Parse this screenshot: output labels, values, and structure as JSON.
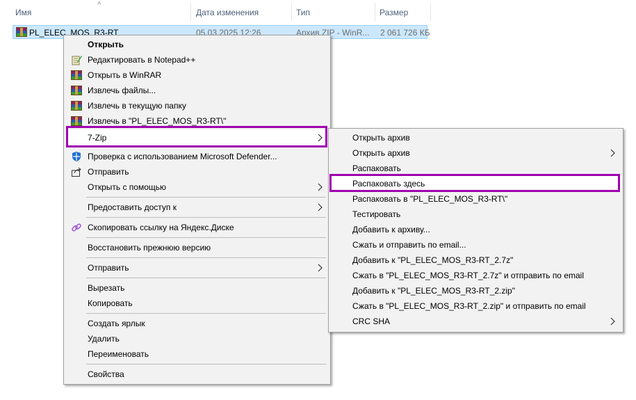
{
  "header": {
    "col_name": "Имя",
    "col_date": "Дата изменения",
    "col_type": "Тип",
    "col_size": "Размер",
    "sort_icon": "sort-up-icon"
  },
  "file": {
    "name": "PL_ELEC_MOS_R3-RT",
    "date": "05.03.2025 12:26",
    "type": "Архив ZIP - WinR...",
    "size": "2 061 726 КБ",
    "icon": "winrar-icon"
  },
  "context_menu": {
    "open": "Открыть",
    "edit_notepad": "Редактировать в Notepad++",
    "open_winrar": "Открыть в WinRAR",
    "extract_files": "Извлечь файлы...",
    "extract_here": "Извлечь в текущую папку",
    "extract_to": "Извлечь в \"PL_ELEC_MOS_R3-RT\\\"",
    "sevenzip": "7-Zip",
    "defender": "Проверка с использованием Microsoft Defender...",
    "share": "Отправить",
    "open_with": "Открыть с помощью",
    "give_access": "Предоставить доступ к",
    "yandex_link": "Скопировать ссылку на Яндекс.Диске",
    "restore": "Восстановить прежнюю версию",
    "send_to": "Отправить",
    "cut": "Вырезать",
    "copy": "Копировать",
    "create_shortcut": "Создать ярлык",
    "delete": "Удалить",
    "rename": "Переименовать",
    "properties": "Свойства"
  },
  "submenu": {
    "open_archive": "Открыть архив",
    "open_archive_sub": "Открыть архив",
    "extract": "Распаковать",
    "extract_here": "Распаковать здесь",
    "extract_to": "Распаковать в \"PL_ELEC_MOS_R3-RT\\\"",
    "test": "Тестировать",
    "add_archive": "Добавить к архиву...",
    "compress_email": "Сжать и отправить по email...",
    "add_7z": "Добавить к \"PL_ELEC_MOS_R3-RT_2.7z\"",
    "compress_7z_email": "Сжать в \"PL_ELEC_MOS_R3-RT_2.7z\" и отправить по email",
    "add_zip": "Добавить к \"PL_ELEC_MOS_R3-RT_2.zip\"",
    "compress_zip_email": "Сжать в \"PL_ELEC_MOS_R3-RT_2.zip\" и отправить по email",
    "crc": "CRC SHA"
  },
  "highlight_color": "#a000b0",
  "selection_color": "#cce8ff"
}
